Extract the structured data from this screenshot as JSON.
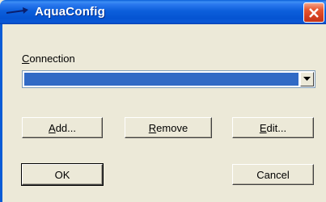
{
  "window": {
    "title": "AquaConfig",
    "title_icon": "arrow-icon",
    "close_icon": "close-icon"
  },
  "connection": {
    "label_mnemonic": "C",
    "label_rest": "onnection",
    "selected_value": "",
    "dropdown_icon": "chevron-down-icon"
  },
  "buttons": {
    "add": {
      "mnemonic": "A",
      "rest": "dd..."
    },
    "remove": {
      "mnemonic": "R",
      "rest": "emove"
    },
    "edit": {
      "mnemonic": "E",
      "rest": "dit..."
    },
    "ok": "OK",
    "cancel": "Cancel"
  },
  "colors": {
    "titlebar": "#0554d2",
    "window_bg": "#ece9d8",
    "selection": "#316ac5",
    "close_button": "#d44022"
  }
}
